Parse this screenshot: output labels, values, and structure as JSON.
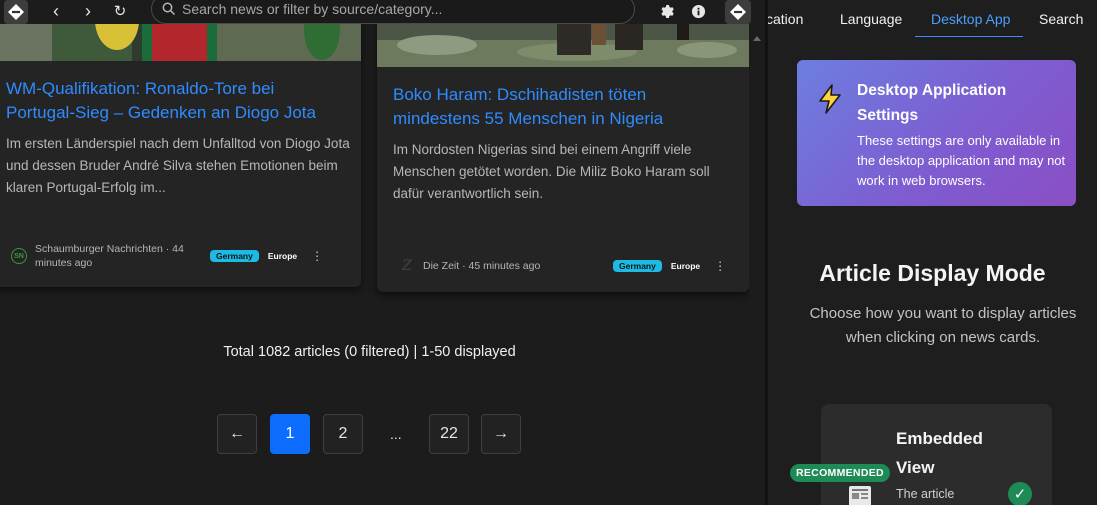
{
  "toolbar": {
    "search_placeholder": "Search news or filter by source/category...",
    "back_glyph": "‹",
    "forward_glyph": "›",
    "reload_glyph": "↻"
  },
  "cards": [
    {
      "title": "WM-Qualifikation: Ronaldo-Tore bei Portugal-Sieg – Gedenken an Diogo Jota",
      "description": "Im ersten Länderspiel nach dem Unfalltod von Diogo Jota und dessen Bruder André Silva stehen Emotionen beim klaren Portugal-Erfolg im...",
      "source_initials": "SN",
      "source": "Schaumburger Nachrichten · 44 minutes ago",
      "country": "Germany",
      "region": "Europe"
    },
    {
      "title": "Boko Haram: Dschihadisten töten mindestens 55 Menschen in Nigeria",
      "description": "Im Nordosten Nigerias sind bei einem Angriff viele Menschen getötet worden. Die Miliz Boko Haram soll dafür verantwortlich sein.",
      "source": "Die Zeit · 45 minutes ago",
      "country": "Germany",
      "region": "Europe"
    }
  ],
  "summary": "Total 1082 articles (0 filtered) | 1-50 displayed",
  "pagination": {
    "prev": "←",
    "pages": [
      "1",
      "2",
      "22"
    ],
    "ellipsis": "...",
    "next": "→",
    "current": "1"
  },
  "settings": {
    "tabs": [
      "cation",
      "Language",
      "Desktop App",
      "Search"
    ],
    "active_tab": "Desktop App",
    "alert": {
      "title": "Desktop Application Settings",
      "text": "These settings are only available in the desktop application and may not work in web browsers."
    },
    "section_title": "Article Display Mode",
    "section_desc": "Choose how you want to display articles when clicking on news cards.",
    "option": {
      "badge": "RECOMMENDED",
      "title": "Embedded View",
      "desc": "The article",
      "check": "✓"
    }
  },
  "colors": {
    "accent": "#0d6efd",
    "link": "#2f8cff",
    "badge_country": "#1bbbe6",
    "recommended": "#1e8a55"
  }
}
